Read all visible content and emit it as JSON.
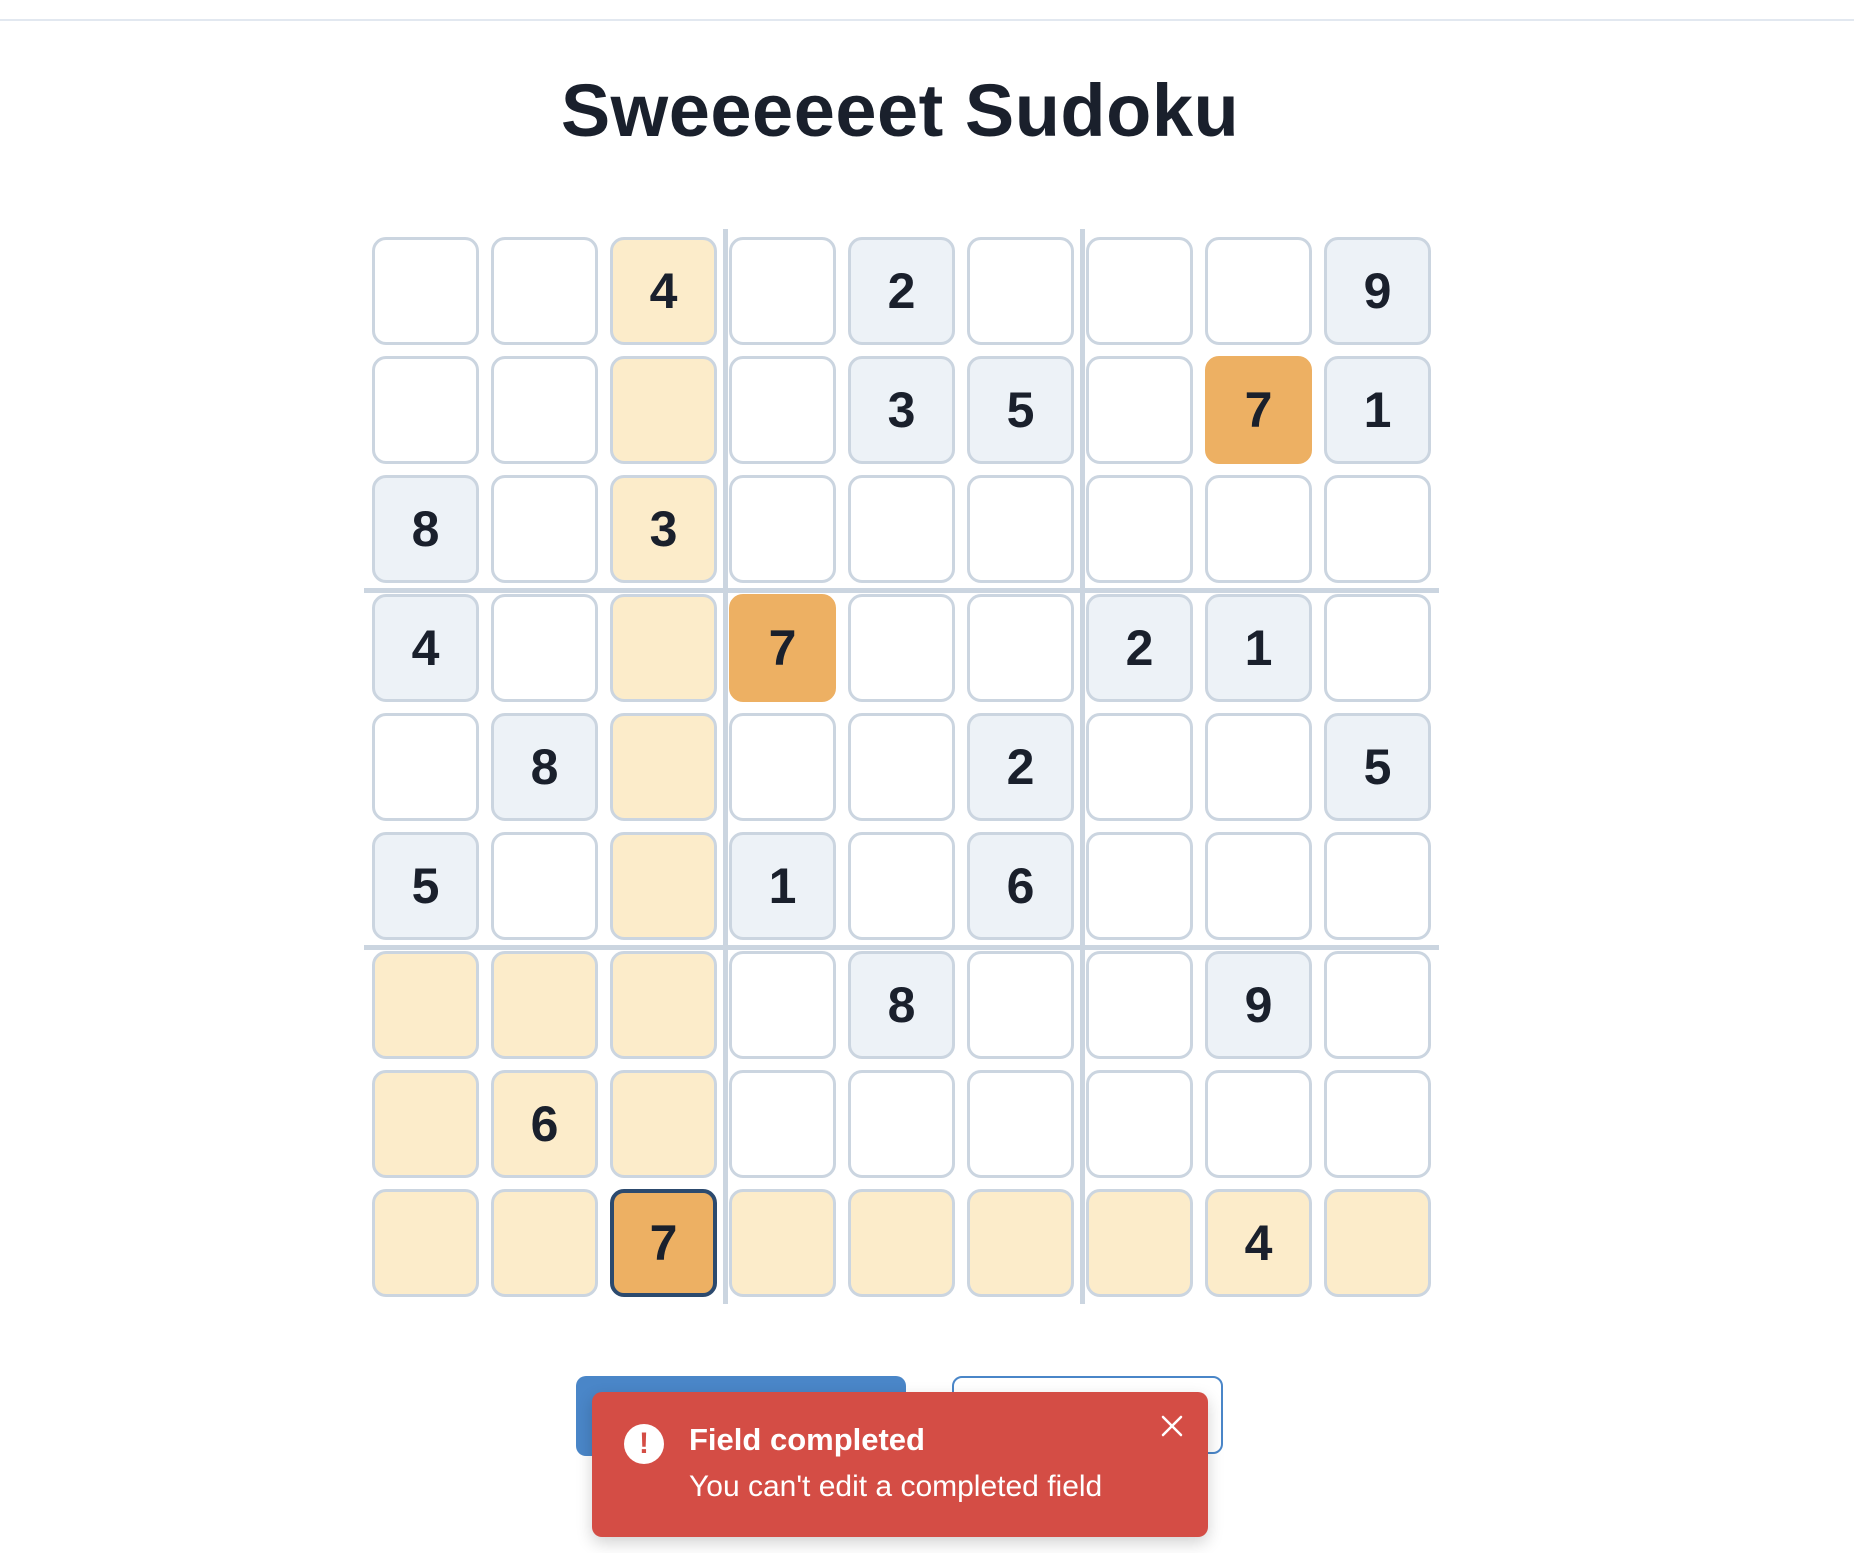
{
  "page": {
    "title": "Sweeeeeet Sudoku"
  },
  "board": {
    "cells": [
      [
        "",
        "",
        "4",
        "",
        "2",
        "",
        "",
        "",
        "9"
      ],
      [
        "",
        "",
        "",
        "",
        "3",
        "5",
        "",
        "7",
        "1"
      ],
      [
        "8",
        "",
        "3",
        "",
        "",
        "",
        "",
        "",
        ""
      ],
      [
        "4",
        "",
        "",
        "7",
        "",
        "",
        "2",
        "1",
        ""
      ],
      [
        "",
        "8",
        "",
        "",
        "",
        "2",
        "",
        "",
        "5"
      ],
      [
        "5",
        "",
        "",
        "1",
        "",
        "6",
        "",
        "",
        ""
      ],
      [
        "",
        "",
        "",
        "",
        "8",
        "",
        "",
        "9",
        ""
      ],
      [
        "",
        "6",
        "",
        "",
        "",
        "",
        "",
        "",
        ""
      ],
      [
        "",
        "",
        "7",
        "",
        "",
        "",
        "",
        "4",
        ""
      ]
    ],
    "states": [
      [
        "empty",
        "empty",
        "hl",
        "empty",
        "given",
        "empty",
        "empty",
        "empty",
        "given"
      ],
      [
        "empty",
        "empty",
        "hl",
        "empty",
        "given",
        "given",
        "empty",
        "same",
        "given"
      ],
      [
        "given",
        "empty",
        "hl",
        "empty",
        "empty",
        "empty",
        "empty",
        "empty",
        "empty"
      ],
      [
        "given",
        "empty",
        "hl",
        "same",
        "empty",
        "empty",
        "given",
        "given",
        "empty"
      ],
      [
        "empty",
        "given",
        "hl",
        "empty",
        "empty",
        "given",
        "empty",
        "empty",
        "given"
      ],
      [
        "given",
        "empty",
        "hl",
        "given",
        "empty",
        "given",
        "empty",
        "empty",
        "empty"
      ],
      [
        "hl",
        "hl",
        "hl",
        "empty",
        "given",
        "empty",
        "empty",
        "given",
        "empty"
      ],
      [
        "hl",
        "hl",
        "hl",
        "empty",
        "empty",
        "empty",
        "empty",
        "empty",
        "empty"
      ],
      [
        "hl",
        "hl",
        "selected",
        "hl",
        "hl",
        "hl",
        "hl",
        "hl",
        "hl"
      ]
    ]
  },
  "toast": {
    "title": "Field completed",
    "description": "You can't edit a completed field",
    "icon": "exclamation-icon",
    "close_icon": "close-icon"
  },
  "colors": {
    "given_bg": "#edf2f7",
    "highlight_bg": "#fcecca",
    "same_number_bg": "#edb063",
    "selected_border": "#2c4a6e",
    "toast_bg": "#d44d45",
    "primary_button": "#4a86c8"
  }
}
